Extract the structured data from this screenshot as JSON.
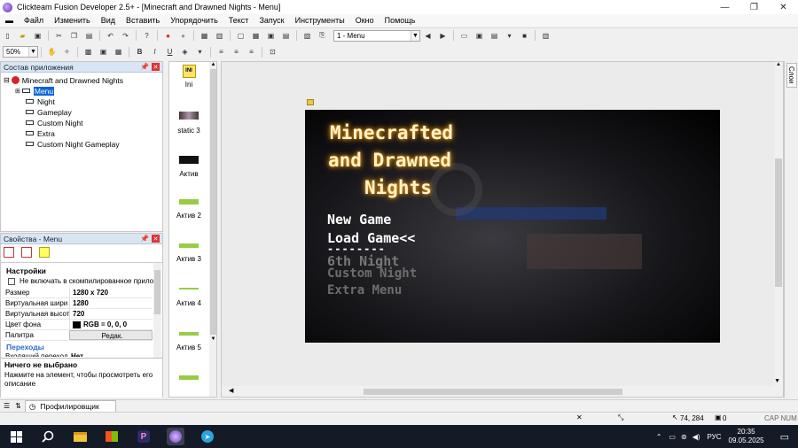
{
  "window": {
    "title": "Clickteam Fusion Developer 2.5+ - [Minecraft and Drawned Nights - Menu]"
  },
  "menu": [
    "Файл",
    "Изменить",
    "Вид",
    "Вставить",
    "Упорядочить",
    "Текст",
    "Запуск",
    "Инструменты",
    "Окно",
    "Помощь"
  ],
  "toolbar": {
    "frame_select": "1 - Menu",
    "zoom": "50%"
  },
  "tree": {
    "title": "Состав приложения",
    "root": "Minecraft and Drawned Nights",
    "frames": [
      "Menu",
      "Night",
      "Gameplay",
      "Custom Night",
      "Extra",
      "Custom Night Gameplay"
    ]
  },
  "props": {
    "title": "Свойства - Menu",
    "section_settings": "Настройки",
    "checkbox_label": "Не включать в скомпилированное прило",
    "rows": [
      {
        "k": "Размер",
        "v": "1280 x 720"
      },
      {
        "k": "Виртуальная шири",
        "v": "1280"
      },
      {
        "k": "Виртуальная высот",
        "v": "720"
      },
      {
        "k": "Цвет фона",
        "v": "RGB = 0, 0, 0"
      },
      {
        "k": "Палитра",
        "v": "Редак."
      }
    ],
    "section_transitions": "Переходы",
    "partial_row": {
      "k": "Входящий переход",
      "v": "Нет"
    },
    "desc_title": "Ничего не выбрано",
    "desc_text": "Нажмите на элемент, чтобы просмотреть его описание"
  },
  "library": [
    "Ini",
    "static 3",
    "Актив",
    "Актив 2",
    "Актив 3",
    "Актив 4",
    "Актив 5"
  ],
  "game": {
    "title_lines": [
      "Minecrafted",
      "and Drawned",
      "Nights"
    ],
    "menu_items": [
      "New Game",
      "Load Game<<",
      "6th Night",
      "Custom Night",
      "Extra Menu"
    ],
    "dash_line": "--------"
  },
  "side_tab": "Слои",
  "status": {
    "tab": "Профилировщик",
    "coords": "74, 284",
    "count": "0",
    "caps": "CAP NUM"
  },
  "taskbar": {
    "lang": "РУС",
    "time": "20:35",
    "date": "09.05.2025"
  }
}
